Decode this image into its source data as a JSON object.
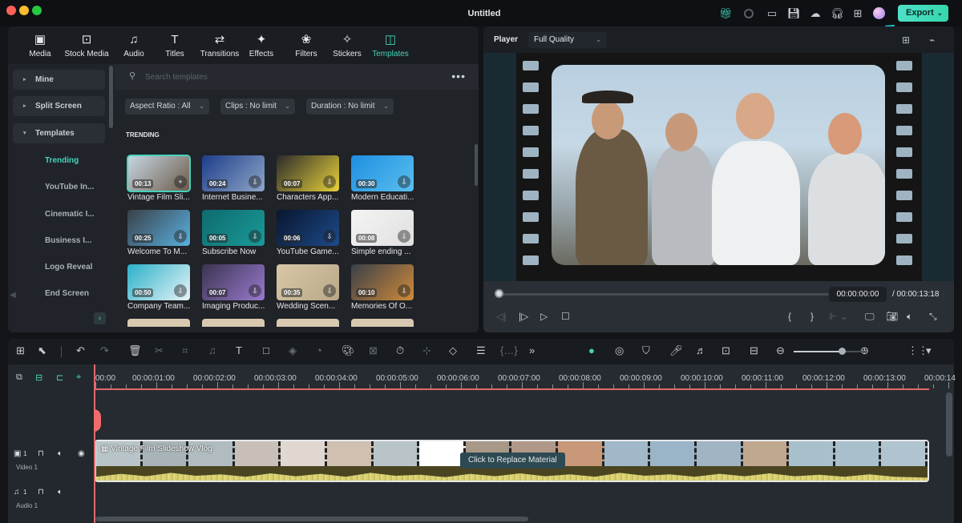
{
  "window": {
    "title": "Untitled",
    "export_label": "Export",
    "toolbar_icons": [
      "gift-icon",
      "record-icon",
      "layout-icon",
      "save-icon",
      "cloud-upload-icon",
      "headset-icon",
      "grid-icon",
      "avatar"
    ]
  },
  "media_tabs": [
    {
      "label": "Media",
      "icon": "media-icon",
      "glyph": "▣"
    },
    {
      "label": "Stock Media",
      "icon": "stock-media-icon",
      "glyph": "⊡"
    },
    {
      "label": "Audio",
      "icon": "audio-icon",
      "glyph": "♫"
    },
    {
      "label": "Titles",
      "icon": "titles-icon",
      "glyph": "T"
    },
    {
      "label": "Transitions",
      "icon": "transitions-icon",
      "glyph": "⇄"
    },
    {
      "label": "Effects",
      "icon": "effects-icon",
      "glyph": "✦"
    },
    {
      "label": "Filters",
      "icon": "filters-icon",
      "glyph": "❀"
    },
    {
      "label": "Stickers",
      "icon": "stickers-icon",
      "glyph": "✧"
    },
    {
      "label": "Templates",
      "icon": "templates-icon",
      "glyph": "◫",
      "active": true
    }
  ],
  "sidebar": {
    "categories": [
      {
        "label": "Mine",
        "expanded": false
      },
      {
        "label": "Split Screen",
        "expanded": false
      },
      {
        "label": "Templates",
        "expanded": true
      }
    ],
    "subitems": [
      "Trending",
      "YouTube In...",
      "Cinematic I...",
      "Business I...",
      "Logo Reveal",
      "End Screen"
    ],
    "active_subitem": "Trending"
  },
  "search": {
    "placeholder": "Search templates",
    "value": ""
  },
  "filters": [
    {
      "label": "Aspect Ratio : All"
    },
    {
      "label": "Clips : No limit"
    },
    {
      "label": "Duration : No limit"
    }
  ],
  "section_title": "TRENDING",
  "templates": [
    {
      "name": "Vintage Film Sli...",
      "duration": "00:13",
      "colors": [
        "#c8d8e4",
        "#6b5a4a"
      ],
      "selected": true
    },
    {
      "name": "Internet Busine...",
      "duration": "00:24",
      "colors": [
        "#1d3d8a",
        "#8ea6c8"
      ]
    },
    {
      "name": "Characters App...",
      "duration": "00:07",
      "colors": [
        "#2a2a2a",
        "#e8d23a"
      ]
    },
    {
      "name": "Modern Educati...",
      "duration": "00:30",
      "colors": [
        "#1e8ee0",
        "#5ac0f0"
      ]
    },
    {
      "name": "Welcome To M...",
      "duration": "00:25",
      "colors": [
        "#3a4048",
        "#5ab0e0"
      ]
    },
    {
      "name": "Subscribe Now",
      "duration": "00:05",
      "colors": [
        "#0e6a6e",
        "#1a9a98"
      ]
    },
    {
      "name": "YouTube Game...",
      "duration": "00:06",
      "colors": [
        "#08162e",
        "#1e4a8a"
      ]
    },
    {
      "name": "Simple ending ...",
      "duration": "00:08",
      "colors": [
        "#f4f4f4",
        "#e0e0e0"
      ]
    },
    {
      "name": "Company Team...",
      "duration": "00:50",
      "colors": [
        "#2ab0c8",
        "#e8f4f8"
      ]
    },
    {
      "name": "Imaging Produc...",
      "duration": "00:07",
      "colors": [
        "#3a3450",
        "#9a7ad0"
      ]
    },
    {
      "name": "Wedding Scen...",
      "duration": "00:35",
      "colors": [
        "#d8c8a8",
        "#b8a888"
      ]
    },
    {
      "name": "Memories Of O...",
      "duration": "00:10",
      "colors": [
        "#3a4048",
        "#d08a3a"
      ]
    }
  ],
  "player": {
    "label": "Player",
    "quality": "Full Quality",
    "current_time": "00:00:00:00",
    "total_time": "/ 00:00:13:18",
    "progress": 0
  },
  "timeline": {
    "ruler_labels": [
      "00:00",
      "00:00:01:00",
      "00:00:02:00",
      "00:00:03:00",
      "00:00:04:00",
      "00:00:05:00",
      "00:00:06:00",
      "00:00:07:00",
      "00:00:08:00",
      "00:00:09:00",
      "00:00:10:00",
      "00:00:11:00",
      "00:00:12:00",
      "00:00:13:00",
      "00:00:14"
    ],
    "tracks": [
      {
        "name": "Video 1",
        "index": "1",
        "type": "video"
      },
      {
        "name": "Audio 1",
        "index": "1",
        "type": "audio"
      }
    ],
    "clip_title": "Vintage Film Slideshow Vlog",
    "tooltip": "Click to Replace Material",
    "zoom_level": 0.67
  },
  "colors": {
    "accent": "#45d3bc",
    "playhead": "#e16a6a",
    "export": "#4fe0c7"
  }
}
